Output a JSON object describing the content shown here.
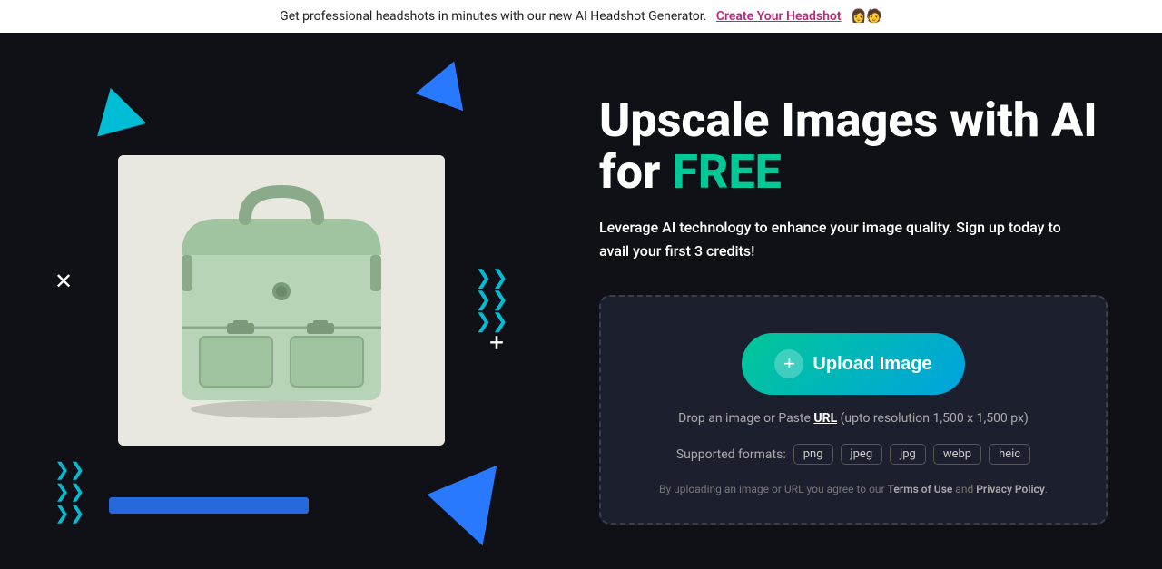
{
  "banner": {
    "text": "Get professional headshots in minutes with our new AI Headshot Generator.",
    "cta_label": "Create Your Headshot",
    "emojis": "👩🧑"
  },
  "hero": {
    "headline_line1": "Upscale Images with AI",
    "headline_line2_prefix": "for ",
    "headline_line2_highlight": "FREE",
    "subtext": "Leverage AI technology to enhance your image quality. Sign up today to avail your first 3 credits!",
    "upload_button_label": "Upload Image",
    "drop_text_prefix": "Drop an image or Paste ",
    "drop_url_label": "URL",
    "drop_text_suffix": " (upto resolution 1,500 x 1,500 px)",
    "formats_label": "Supported formats:",
    "formats": [
      "png",
      "jpeg",
      "jpg",
      "webp",
      "heic"
    ],
    "terms_prefix": "By uploading an image or URL you agree to our ",
    "terms_of_use": "Terms of Use",
    "terms_and": " and ",
    "privacy_policy": "Privacy Policy",
    "terms_suffix": "."
  },
  "colors": {
    "accent_teal": "#00c896",
    "accent_blue": "#00a3e0",
    "url_underline": "#ffffff",
    "banner_link": "#c0257e"
  }
}
